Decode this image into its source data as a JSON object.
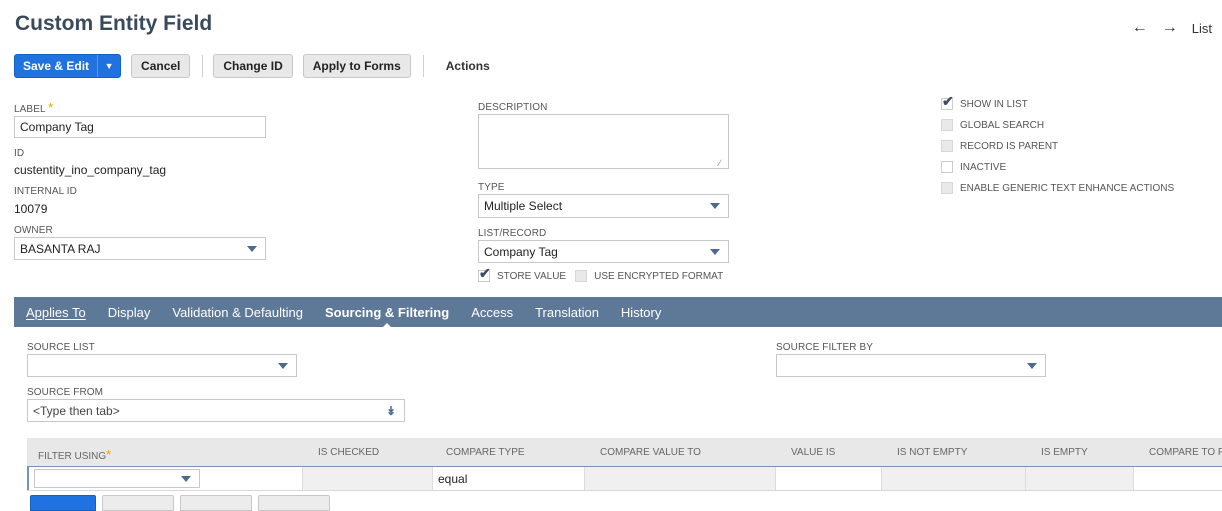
{
  "header": {
    "title": "Custom Entity Field",
    "nav_list": "List"
  },
  "toolbar": {
    "save_edit": "Save & Edit",
    "cancel": "Cancel",
    "change_id": "Change ID",
    "apply_to_forms": "Apply to Forms",
    "actions": "Actions"
  },
  "fields": {
    "label_label": "LABEL",
    "label_value": "Company Tag",
    "id_label": "ID",
    "id_value": "custentity_ino_company_tag",
    "internal_id_label": "INTERNAL ID",
    "internal_id_value": "10079",
    "owner_label": "OWNER",
    "owner_value": "BASANTA RAJ",
    "description_label": "DESCRIPTION",
    "description_value": "",
    "type_label": "TYPE",
    "type_value": "Multiple Select",
    "list_record_label": "LIST/RECORD",
    "list_record_value": "Company Tag",
    "store_value_label": "STORE VALUE",
    "store_value_checked": true,
    "use_encrypted_label": "USE ENCRYPTED FORMAT",
    "use_encrypted_checked": false
  },
  "options": [
    {
      "label": "SHOW IN LIST",
      "checked": true,
      "disabled": false
    },
    {
      "label": "GLOBAL SEARCH",
      "checked": false,
      "disabled": true
    },
    {
      "label": "RECORD IS PARENT",
      "checked": false,
      "disabled": true
    },
    {
      "label": "INACTIVE",
      "checked": false,
      "disabled": false
    },
    {
      "label": "ENABLE GENERIC TEXT ENHANCE ACTIONS",
      "checked": false,
      "disabled": true
    }
  ],
  "tabs": [
    {
      "label": "Applies To",
      "active": false
    },
    {
      "label": "Display",
      "active": false
    },
    {
      "label": "Validation & Defaulting",
      "active": false
    },
    {
      "label": "Sourcing & Filtering",
      "active": true
    },
    {
      "label": "Access",
      "active": false
    },
    {
      "label": "Translation",
      "active": false
    },
    {
      "label": "History",
      "active": false
    }
  ],
  "sourcing": {
    "source_list_label": "SOURCE LIST",
    "source_list_value": "",
    "source_from_label": "SOURCE FROM",
    "source_from_placeholder": "<Type then tab>",
    "source_filter_by_label": "SOURCE FILTER BY",
    "source_filter_by_value": ""
  },
  "filter_table": {
    "columns": [
      "FILTER USING",
      "IS CHECKED",
      "COMPARE TYPE",
      "COMPARE VALUE TO",
      "VALUE IS",
      "IS NOT EMPTY",
      "IS EMPTY",
      "COMPARE TO FI"
    ],
    "row": {
      "filter_using": "",
      "compare_type": "equal"
    }
  },
  "colors": {
    "accent": "#1f72e0",
    "tabbar": "#5e7898",
    "title": "#3a4a5a"
  },
  "icons": [
    "back-arrow-icon",
    "forward-arrow-icon",
    "dropdown-caret-icon",
    "checkmark-icon",
    "double-chevron-down-icon"
  ]
}
